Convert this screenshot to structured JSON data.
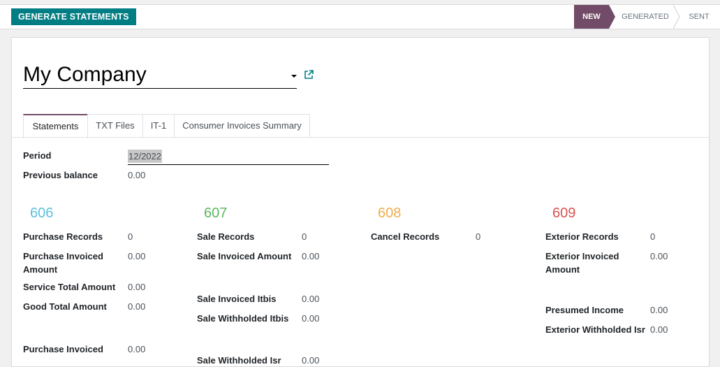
{
  "toolbar": {
    "generate_label": "GENERATE STATEMENTS"
  },
  "statusbar": {
    "steps": [
      "NEW",
      "GENERATED",
      "SENT"
    ],
    "active": "NEW"
  },
  "form": {
    "company": "My Company",
    "tabs": [
      "Statements",
      "TXT Files",
      "IT-1",
      "Consumer Invoices Summary"
    ],
    "period_label": "Period",
    "period_value": "12/2022",
    "previous_balance_label": "Previous balance",
    "previous_balance_value": "0.00"
  },
  "sections": {
    "s606": {
      "title": "606",
      "color": "#5bc0de",
      "purchase_records_label": "Purchase Records",
      "purchase_records_value": "0",
      "purchase_invoiced_amount_label_1": "Purchase Invoiced",
      "purchase_invoiced_amount_label_2": "Amount",
      "purchase_invoiced_amount_value": "0.00",
      "service_total_label": "Service Total Amount",
      "service_total_value": "0.00",
      "good_total_label": "Good Total Amount",
      "good_total_value": "0.00",
      "purchase_invoiced_2_label": "Purchase Invoiced",
      "purchase_invoiced_2_value": "0.00"
    },
    "s607": {
      "title": "607",
      "color": "#5cb85c",
      "sale_records_label": "Sale Records",
      "sale_records_value": "0",
      "sale_invoiced_amount_label": "Sale Invoiced Amount",
      "sale_invoiced_amount_value": "0.00",
      "sale_invoiced_itbis_label": "Sale Invoiced Itbis",
      "sale_invoiced_itbis_value": "0.00",
      "sale_withholded_itbis_label": "Sale Withholded Itbis",
      "sale_withholded_itbis_value": "0.00",
      "sale_withholded_isr_label": "Sale Withholded Isr",
      "sale_withholded_isr_value": "0.00"
    },
    "s608": {
      "title": "608",
      "color": "#f0ad4e",
      "cancel_records_label": "Cancel Records",
      "cancel_records_value": "0"
    },
    "s609": {
      "title": "609",
      "color": "#d9534f",
      "exterior_records_label": "Exterior Records",
      "exterior_records_value": "0",
      "exterior_invoiced_amount_label_1": "Exterior Invoiced",
      "exterior_invoiced_amount_label_2": "Amount",
      "exterior_invoiced_amount_value": "0.00",
      "presumed_income_label": "Presumed Income",
      "presumed_income_value": "0.00",
      "exterior_withholded_isr_label": "Exterior Withholded Isr",
      "exterior_withholded_isr_value": "0.00"
    }
  }
}
